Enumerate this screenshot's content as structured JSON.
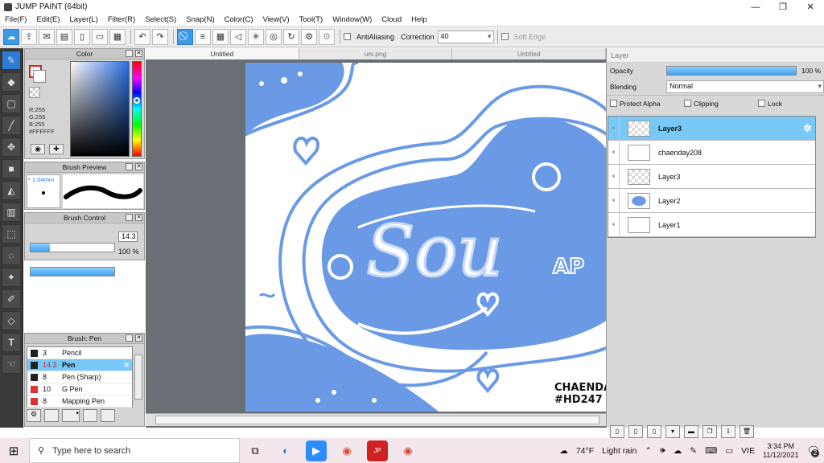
{
  "window": {
    "title": "JUMP PAINT (64bit)"
  },
  "menu": [
    "File(F)",
    "Edit(E)",
    "Layer(L)",
    "Filter(R)",
    "Select(S)",
    "Snap(N)",
    "Color(C)",
    "View(V)",
    "Tool(T)",
    "Window(W)",
    "Cloud",
    "Help"
  ],
  "toolbar": {
    "antialias_label": "AntiAliasing",
    "correction_label": "Correction",
    "correction_value": "40",
    "soft_edge_label": "Soft Edge"
  },
  "color_panel": {
    "title": "Color",
    "r": "R:255",
    "g": "G:255",
    "b": "B:255",
    "hex": "#FFFFFF"
  },
  "brush_preview": {
    "title": "Brush Preview",
    "size": "* 1.04mm"
  },
  "brush_control": {
    "title": "Brush Control",
    "size_value": "14.3",
    "opacity_value": "100 %",
    "size_fraction": 0.23,
    "opacity_fraction": 1.0
  },
  "brush_list": {
    "title": "Brush: Pen",
    "items": [
      {
        "size": "3",
        "name": "Pencil",
        "color": "#222222"
      },
      {
        "size": "14.3",
        "name": "Pen",
        "color": "#222222"
      },
      {
        "size": "8",
        "name": "Pen (Sharp)",
        "color": "#222222"
      },
      {
        "size": "10",
        "name": "G Pen",
        "color": "#e03030"
      },
      {
        "size": "8",
        "name": "Mapping Pen",
        "color": "#e03030"
      }
    ]
  },
  "tabs": [
    "Untitled",
    "uni.png",
    "Untitled"
  ],
  "canvas": {
    "main_text": "Sou",
    "signature_line1": "CHAENDA",
    "signature_line2": "#HD247",
    "accent": "#6a9ae6"
  },
  "layer_panel": {
    "title": "Layer",
    "opacity_label": "Opacity",
    "opacity_value": "100 %",
    "blending_label": "Blending",
    "blending_value": "Normal",
    "protect_alpha": "Protect Alpha",
    "clipping": "Clipping",
    "lock": "Lock",
    "layers": [
      "Layer3",
      "chaenday208",
      "Layer3",
      "Layer2",
      "Layer1"
    ]
  },
  "taskbar": {
    "search_placeholder": "Type here to search",
    "weather_temp": "74°F",
    "weather_text": "Light rain",
    "lang": "VIE",
    "time": "3:34 PM",
    "date": "11/12/2021",
    "notif_count": "2"
  }
}
